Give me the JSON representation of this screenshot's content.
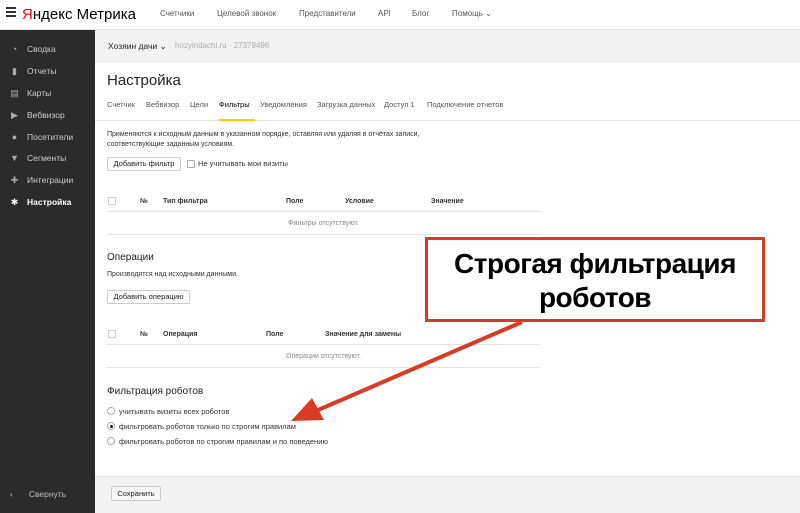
{
  "brand": {
    "logo_y": "Я",
    "logo_rest": "ндекс",
    "product": "Метрика"
  },
  "topnav": [
    "Счетчики",
    "Целевой звонок",
    "Представители",
    "API",
    "Блог",
    "Помощь"
  ],
  "sidebar": {
    "items": [
      {
        "label": "Сводка",
        "icon": "speedometer-icon"
      },
      {
        "label": "Отчеты",
        "icon": "bar-chart-icon"
      },
      {
        "label": "Карты",
        "icon": "map-icon"
      },
      {
        "label": "Вебвизор",
        "icon": "play-icon"
      },
      {
        "label": "Посетители",
        "icon": "person-icon"
      },
      {
        "label": "Сегменты",
        "icon": "funnel-icon"
      },
      {
        "label": "Интеграции",
        "icon": "puzzle-icon"
      },
      {
        "label": "Настройка",
        "icon": "gear-icon"
      }
    ],
    "collapse_label": "Свернуть"
  },
  "counter": {
    "name": "Хозяин дачи",
    "site": "hozyindachi.ru · 27379496"
  },
  "page_title": "Настройка",
  "tabs": [
    "Счетчик",
    "Вебвизор",
    "Цели",
    "Фильтры",
    "Уведомления",
    "Загрузка данных",
    "Доступ 1",
    "Подключение отчетов"
  ],
  "filters": {
    "description": "Применяются к исходным данным в указанном порядке, оставляя или удаляя в отчётах записи, соответствующие заданным условиям.",
    "add_button": "Добавить фильтр",
    "ignore_my_visits": "Не учитывать мои визиты",
    "columns": [
      "№",
      "Тип фильтра",
      "Поле",
      "Условие",
      "Значение"
    ],
    "empty": "Фильтры отсутствуют."
  },
  "operations": {
    "title": "Операции",
    "description": "Производятся над исходными данными.",
    "add_button": "Добавить операцию",
    "columns": [
      "№",
      "Операция",
      "Поле",
      "Значение для замены"
    ],
    "empty": "Операции отсутствуют."
  },
  "robots": {
    "title": "Фильтрация роботов",
    "options": [
      {
        "label": "учитывать визиты всех роботов",
        "selected": false
      },
      {
        "label": "фильтровать роботов только по строгим правилам",
        "selected": true
      },
      {
        "label": "фильтровать роботов по строгим правилам и по поведению",
        "selected": false
      }
    ]
  },
  "save_button": "Сохранить",
  "annotation": {
    "line1": "Строгая фильтрация",
    "line2": "роботов",
    "color": "#d93a24"
  }
}
